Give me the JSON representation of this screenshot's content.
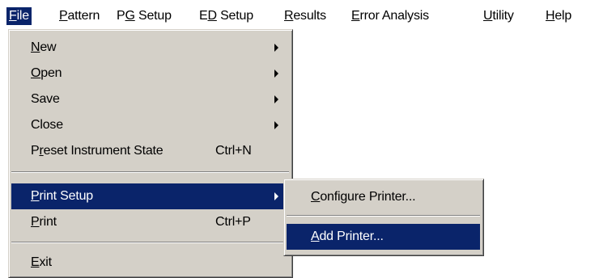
{
  "menubar": {
    "items": [
      {
        "mnemonic": "F",
        "rest": "ile"
      },
      {
        "mnemonic": "P",
        "rest": "attern"
      },
      {
        "pre": "P",
        "mnemonic": "G",
        "rest": " Setup"
      },
      {
        "pre": "E",
        "mnemonic": "D",
        "rest": " Setup"
      },
      {
        "mnemonic": "R",
        "rest": "esults"
      },
      {
        "mnemonic": "E",
        "rest": "rror Analysis"
      },
      {
        "mnemonic": "U",
        "rest": "tility"
      },
      {
        "mnemonic": "H",
        "rest": "elp"
      }
    ]
  },
  "file_menu": {
    "items": [
      {
        "mnemonic": "N",
        "rest": "ew"
      },
      {
        "mnemonic": "O",
        "rest": "pen"
      },
      {
        "label": "Save"
      },
      {
        "label": "Close"
      },
      {
        "pre": "P",
        "mnemonic": "r",
        "rest": "eset Instrument State",
        "shortcut": "Ctrl+N"
      },
      {
        "mnemonic": "P",
        "rest": "rint Setup"
      },
      {
        "mnemonic": "P",
        "rest": "rint",
        "shortcut": "Ctrl+P"
      },
      {
        "mnemonic": "E",
        "rest": "xit"
      }
    ]
  },
  "print_setup_submenu": {
    "items": [
      {
        "mnemonic": "C",
        "rest": "onfigure Printer..."
      },
      {
        "mnemonic": "A",
        "rest": "dd Printer..."
      }
    ]
  },
  "colors": {
    "menu_face": "#d4d0c8",
    "highlight": "#0a246a",
    "highlight_text": "#ffffff"
  },
  "icons": {
    "submenu_arrow": "triangle-right-icon"
  }
}
